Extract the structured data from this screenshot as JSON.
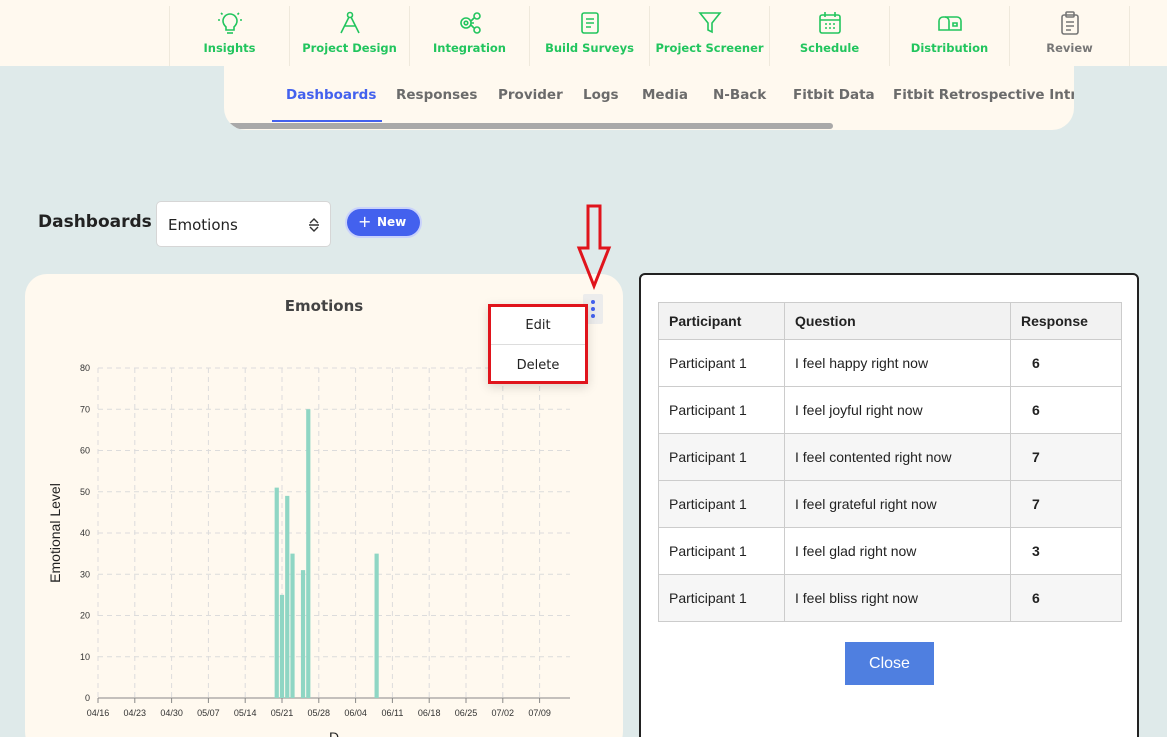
{
  "nav": {
    "items": [
      {
        "label": "Insights",
        "icon": "lightbulb-icon"
      },
      {
        "label": "Project Design",
        "icon": "compass-icon"
      },
      {
        "label": "Integration",
        "icon": "gears-icon"
      },
      {
        "label": "Build Surveys",
        "icon": "document-icon"
      },
      {
        "label": "Project Screener",
        "icon": "filter-icon"
      },
      {
        "label": "Schedule",
        "icon": "calendar-icon"
      },
      {
        "label": "Distribution",
        "icon": "mailbox-icon"
      },
      {
        "label": "Review",
        "icon": "clipboard-icon"
      }
    ],
    "accent": "#22c55e"
  },
  "tabs": [
    "Dashboards",
    "Responses",
    "Provider",
    "Logs",
    "Media",
    "N-Back",
    "Fitbit Data",
    "Fitbit Retrospective Intrad"
  ],
  "dashboards": {
    "title": "Dashboards",
    "selected": "Emotions",
    "new_label": "New"
  },
  "menu": {
    "edit": "Edit",
    "delete": "Delete"
  },
  "chart_data": {
    "type": "bar",
    "title": "Emotions",
    "ylabel": "Emotional Level",
    "xlabel": "D",
    "ylim": [
      0,
      80
    ],
    "yticks": [
      0,
      10,
      20,
      30,
      40,
      50,
      60,
      70,
      80
    ],
    "xticks": [
      "04/16",
      "04/23",
      "04/30",
      "05/07",
      "05/14",
      "05/21",
      "05/28",
      "06/04",
      "06/11",
      "06/18",
      "06/25",
      "07/02",
      "07/09"
    ],
    "grid": true,
    "color": "#8fd6c4",
    "bars": [
      {
        "date": "05/20",
        "value": 51
      },
      {
        "date": "05/21",
        "value": 25
      },
      {
        "date": "05/22",
        "value": 49
      },
      {
        "date": "05/23",
        "value": 35
      },
      {
        "date": "05/25",
        "value": 31
      },
      {
        "date": "05/26",
        "value": 70
      },
      {
        "date": "06/08",
        "value": 35
      }
    ]
  },
  "table": {
    "headers": [
      "Participant",
      "Question",
      "Response"
    ],
    "rows": [
      [
        "Participant 1",
        "I feel happy right now",
        "6"
      ],
      [
        "Participant 1",
        "I feel joyful right now",
        "6"
      ],
      [
        "Participant 1",
        "I feel contented right now",
        "7"
      ],
      [
        "Participant 1",
        "I feel grateful right now",
        "7"
      ],
      [
        "Participant 1",
        "I feel glad right now",
        "3"
      ],
      [
        "Participant 1",
        "I feel bliss right now",
        "6"
      ]
    ],
    "close_label": "Close"
  },
  "colors": {
    "primary": "#4361ee",
    "highlight": "#e0141c",
    "background": "#dfeaea",
    "card": "#fff9ef"
  }
}
